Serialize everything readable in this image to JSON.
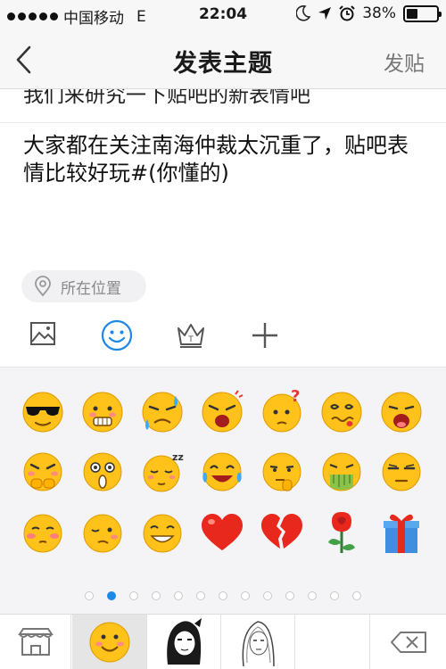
{
  "status_bar": {
    "carrier": "中国移动",
    "network": "E",
    "time": "22:04",
    "battery_percent": "38%",
    "battery_level": 0.38,
    "icons": [
      "signal-dots-icon",
      "moon-icon",
      "location-arrow-icon",
      "alarm-icon",
      "battery-icon"
    ]
  },
  "nav": {
    "back_icon": "chevron-left-icon",
    "title": "发表主题",
    "post_label": "发贴"
  },
  "compose": {
    "title_text": "我们来研究一下贴吧的新表情吧",
    "body_text": "大家都在关注南海仲裁太沉重了，贴吧表情比较好玩#(你懂的)",
    "location_label": "所在位置",
    "location_icon": "map-pin-icon"
  },
  "toolbar": {
    "items": [
      "image-icon",
      "smiley-icon",
      "crown-icon",
      "plus-icon"
    ],
    "active": "smiley-icon"
  },
  "emoji_panel": {
    "rows": [
      [
        "cool-sunglasses",
        "grimace",
        "sweat-crying",
        "shocked-angry",
        "question-confused",
        "dizzy-tongue",
        "yawn"
      ],
      [
        "angry-fist",
        "surprised",
        "sleepy-zzz",
        "laugh-tears",
        "thinking",
        "vomit",
        "annoyed"
      ],
      [
        "blush",
        "wink-shy",
        "grin-teeth",
        "red-heart",
        "broken-heart",
        "rose",
        "gift-box"
      ]
    ],
    "page_count": 13,
    "current_page": 2
  },
  "pack_bar": {
    "packs": [
      "store-icon",
      "smiley-pack-icon",
      "girl-sticker-icon",
      "sketch-girl-icon"
    ],
    "selected": "smiley-pack-icon",
    "delete_icon": "backspace-icon"
  },
  "colors": {
    "accent_blue": "#1e88e5",
    "emoji_yellow": "#ffc21a",
    "heart_red": "#e8281c",
    "panel_bg": "#f4f4f6"
  }
}
